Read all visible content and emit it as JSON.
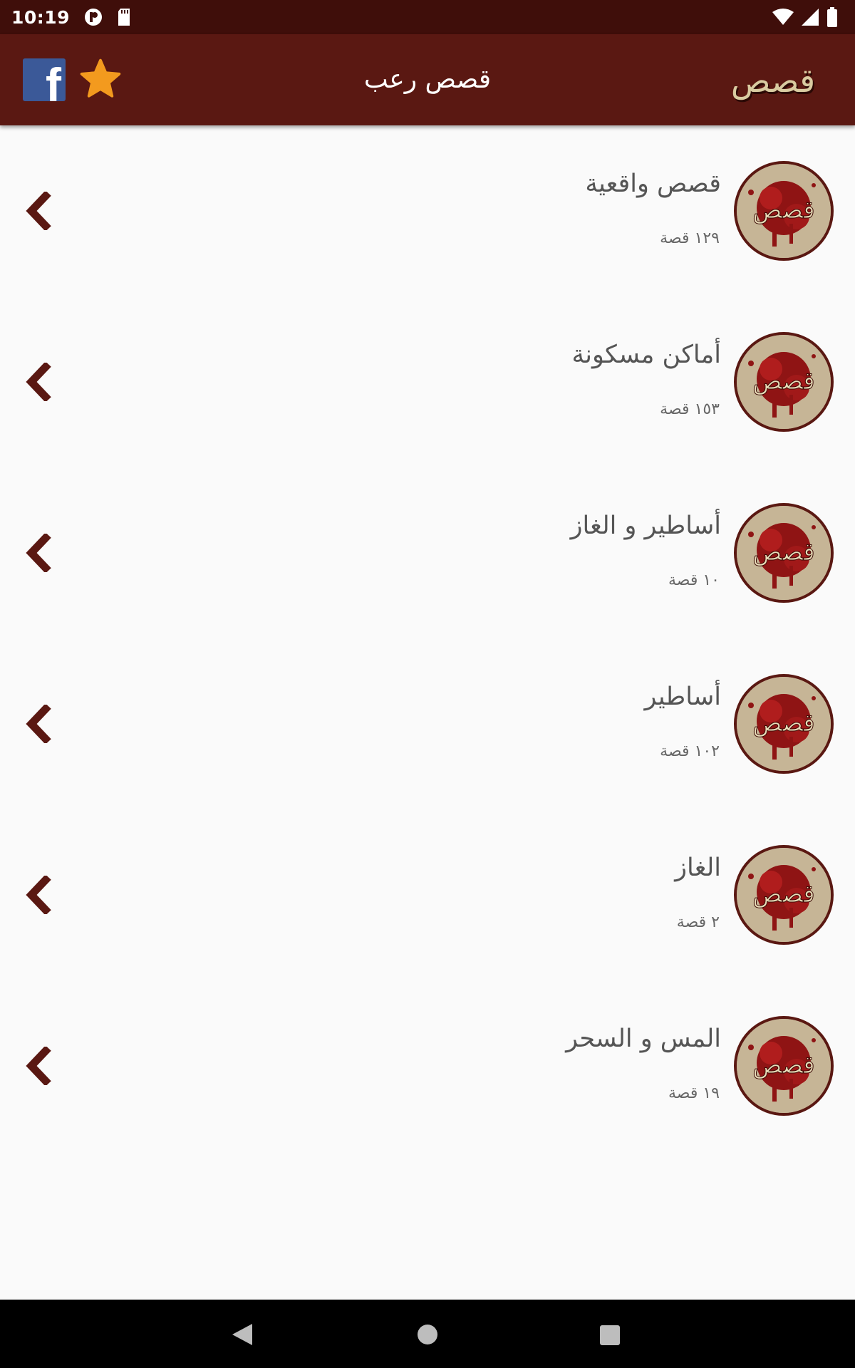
{
  "status_bar": {
    "time": "10:19"
  },
  "app_bar": {
    "title": "قصص رعب",
    "logo_text": "قصص"
  },
  "colors": {
    "primary": "#5a1812",
    "primary_dark": "#3f0e0a",
    "star": "#f39a1e",
    "facebook": "#3b5998"
  },
  "categories": [
    {
      "title": "قصص واقعية",
      "count": "١٢٩ قصة"
    },
    {
      "title": "أماكن مسكونة",
      "count": "١٥٣ قصة"
    },
    {
      "title": "أساطير و الغاز",
      "count": "١٠ قصة"
    },
    {
      "title": "أساطير",
      "count": "١٠٢ قصة"
    },
    {
      "title": "الغاز",
      "count": "٢ قصة"
    },
    {
      "title": "المس و السحر",
      "count": "١٩ قصة"
    }
  ],
  "avatar_text": "قصص"
}
